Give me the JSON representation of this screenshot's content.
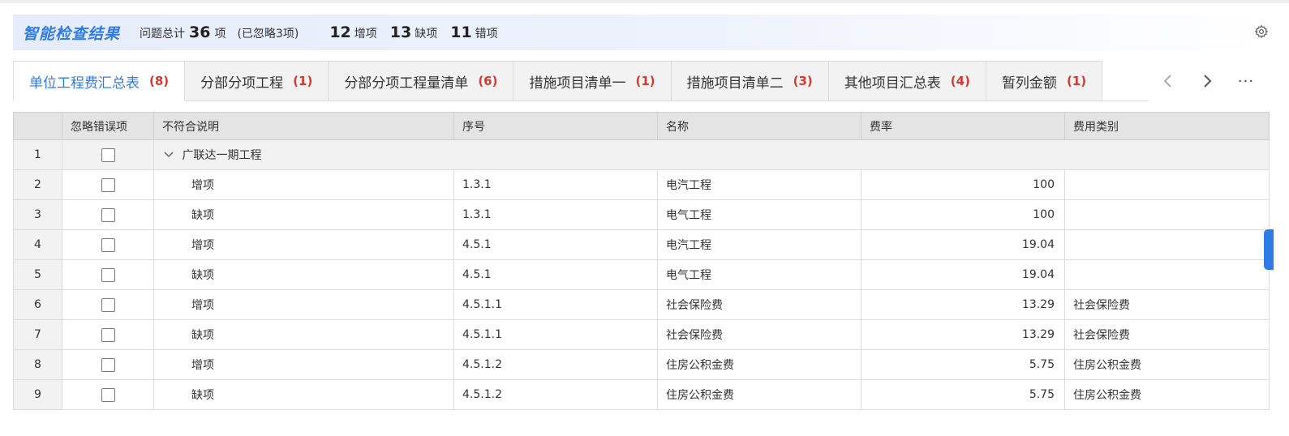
{
  "header": {
    "title": "智能检查结果",
    "total_label": "问题总计",
    "total_count": "36",
    "total_unit": "项",
    "ignored_text": "(已忽略3项)",
    "added_count": "12",
    "added_label": "增项",
    "missing_count": "13",
    "missing_label": "缺项",
    "error_count": "11",
    "error_label": "错项",
    "settings_icon": "gear-icon"
  },
  "tabs": [
    {
      "label": "单位工程费汇总表",
      "count": "(8)",
      "active": true
    },
    {
      "label": "分部分项工程",
      "count": "(1)",
      "active": false
    },
    {
      "label": "分部分项工程量清单",
      "count": "(6)",
      "active": false
    },
    {
      "label": "措施项目清单一",
      "count": "(1)",
      "active": false
    },
    {
      "label": "措施项目清单二",
      "count": "(3)",
      "active": false
    },
    {
      "label": "其他项目汇总表",
      "count": "(4)",
      "active": false
    },
    {
      "label": "暂列金额",
      "count": "(1)",
      "active": false
    }
  ],
  "tab_nav": {
    "more": "···"
  },
  "table": {
    "columns": [
      "忽略错误项",
      "不符合说明",
      "序号",
      "名称",
      "费率",
      "费用类别"
    ],
    "group": {
      "index": "1",
      "label": "广联达一期工程"
    },
    "rows": [
      {
        "index": "2",
        "desc": "增项",
        "seq": "1.3.1",
        "name": "电汽工程",
        "rate": "100",
        "category": ""
      },
      {
        "index": "3",
        "desc": "缺项",
        "seq": "1.3.1",
        "name": "电气工程",
        "rate": "100",
        "category": ""
      },
      {
        "index": "4",
        "desc": "增项",
        "seq": "4.5.1",
        "name": "电汽工程",
        "rate": "19.04",
        "category": ""
      },
      {
        "index": "5",
        "desc": "缺项",
        "seq": "4.5.1",
        "name": "电气工程",
        "rate": "19.04",
        "category": ""
      },
      {
        "index": "6",
        "desc": "增项",
        "seq": "4.5.1.1",
        "name": "社会保险费",
        "rate": "13.29",
        "category": "社会保险费"
      },
      {
        "index": "7",
        "desc": "缺项",
        "seq": "4.5.1.1",
        "name": "社会保险费",
        "rate": "13.29",
        "category": "社会保险费"
      },
      {
        "index": "8",
        "desc": "增项",
        "seq": "4.5.1.2",
        "name": "住房公积金费",
        "rate": "5.75",
        "category": "住房公积金费"
      },
      {
        "index": "9",
        "desc": "缺项",
        "seq": "4.5.1.2",
        "name": "住房公积金费",
        "rate": "5.75",
        "category": "住房公积金费"
      }
    ]
  },
  "colors": {
    "accent": "#2f7be6",
    "count_red": "#d13a2f"
  }
}
